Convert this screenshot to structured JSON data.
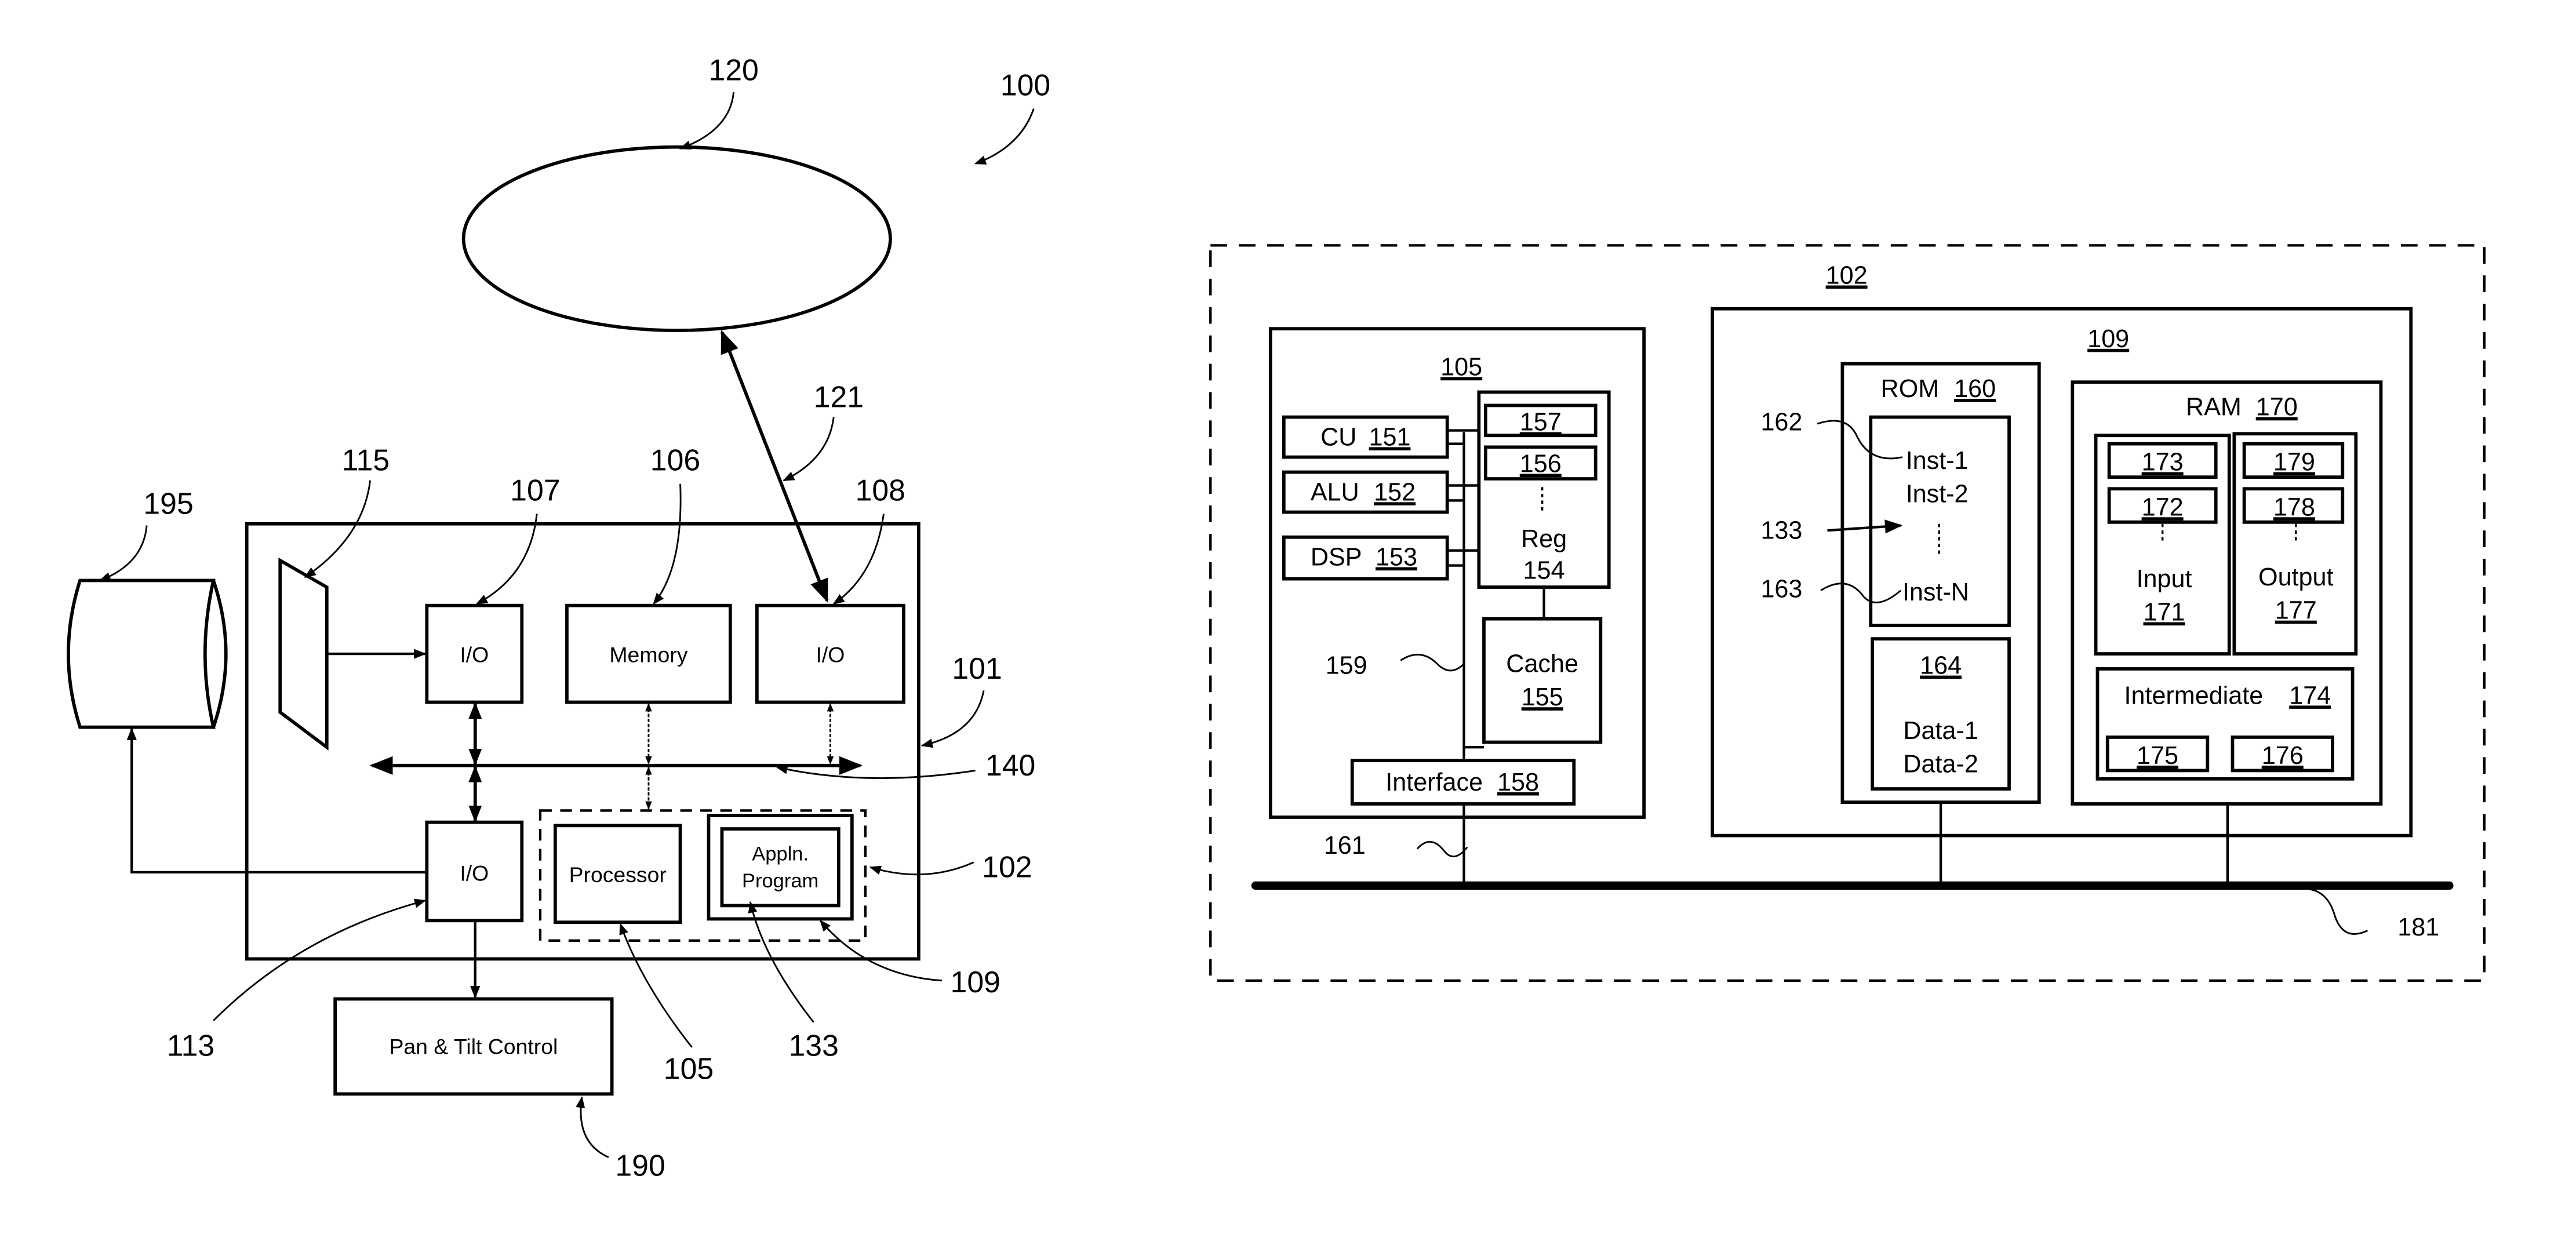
{
  "figure": {
    "system_label": "100",
    "left": {
      "network": {
        "ref": "120"
      },
      "connection": {
        "ref": "121"
      },
      "storage": {
        "ref": "195"
      },
      "sensor": {
        "ref": "115"
      },
      "computer": {
        "ref": "101"
      },
      "io_107": {
        "label": "I/O",
        "ref": "107"
      },
      "memory": {
        "label": "Memory",
        "ref": "106"
      },
      "io_108": {
        "label": "I/O",
        "ref": "108"
      },
      "bus": {
        "ref": "140"
      },
      "io_113": {
        "label": "I/O",
        "ref": "113"
      },
      "embedded_controller": {
        "ref": "102"
      },
      "processor": {
        "label": "Processor",
        "ref": "105"
      },
      "storage_module": {
        "ref": "109"
      },
      "app_program": {
        "label_line1": "Appln.",
        "label_line2": "Program",
        "ref": "133"
      },
      "pan_tilt": {
        "label": "Pan & Tilt Control",
        "ref": "190"
      }
    },
    "right": {
      "outer_ref": "102",
      "processor": {
        "ref": "105",
        "cu": {
          "label": "CU",
          "ref": "151"
        },
        "alu": {
          "label": "ALU",
          "ref": "152"
        },
        "dsp": {
          "label": "DSP",
          "ref": "153"
        },
        "reg": {
          "label": "Reg",
          "ref": "154",
          "items": [
            "157",
            "156"
          ]
        },
        "cache": {
          "label": "Cache",
          "ref": "155"
        },
        "interface": {
          "label": "Interface",
          "ref": "158"
        },
        "internal_bus_ref": "159",
        "connection_ref": "161"
      },
      "storage": {
        "ref": "109",
        "rom": {
          "label": "ROM",
          "ref": "160",
          "instructions": [
            "Inst-1",
            "Inst-2",
            "Inst-N"
          ],
          "inst1_ref": "162",
          "program_ref": "133",
          "instN_ref": "163",
          "data_block": {
            "ref": "164",
            "items": [
              "Data-1",
              "Data-2"
            ]
          }
        },
        "ram": {
          "label": "RAM",
          "ref": "170",
          "input": {
            "label": "Input",
            "ref": "171",
            "items": [
              "173",
              "172"
            ]
          },
          "output": {
            "label": "Output",
            "ref": "177",
            "items": [
              "179",
              "178"
            ]
          },
          "intermediate": {
            "label": "Intermediate",
            "ref": "174",
            "items": [
              "175",
              "176"
            ]
          }
        }
      },
      "system_bus_ref": "181"
    }
  }
}
